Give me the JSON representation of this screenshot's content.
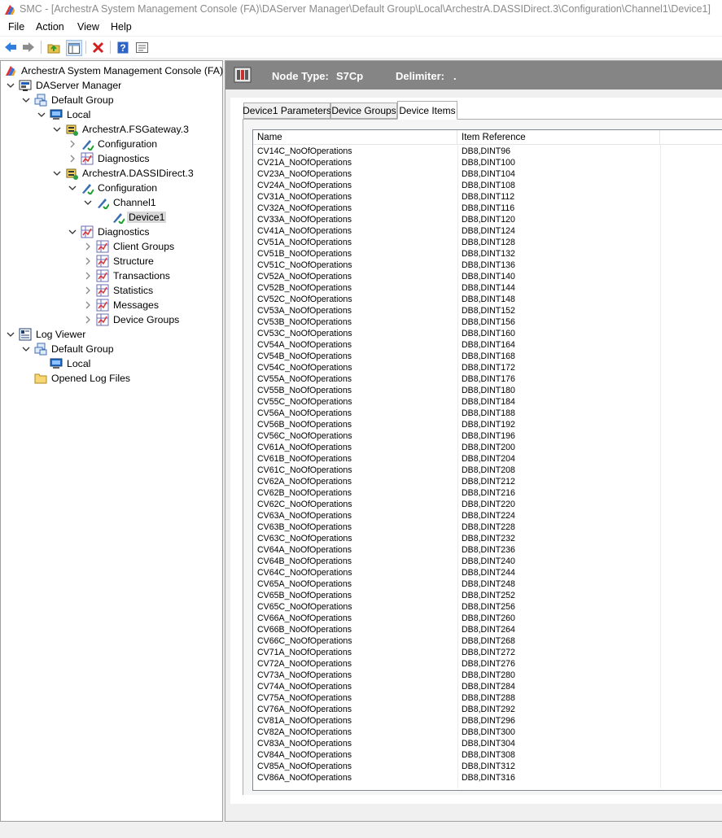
{
  "window": {
    "title": "SMC - [ArchestrA System Management Console (FA)\\DAServer Manager\\Default Group\\Local\\ArchestrA.DASSIDirect.3\\Configuration\\Channel1\\Device1]"
  },
  "menu": [
    "File",
    "Action",
    "View",
    "Help"
  ],
  "toolbar": {
    "icons": [
      "back-arrow-icon",
      "forward-arrow-icon",
      "up-folder-icon",
      "show-hide-tree-icon",
      "delete-icon",
      "help-icon",
      "properties-icon"
    ]
  },
  "tree": [
    {
      "label": "ArchestrA System Management Console (FA)",
      "level": 0,
      "expander": "none",
      "icon": "smc-icon"
    },
    {
      "label": "DAServer Manager",
      "level": 0,
      "expander": "open",
      "icon": "daserver-manager-icon"
    },
    {
      "label": "Default Group",
      "level": 1,
      "expander": "open",
      "icon": "group-icon"
    },
    {
      "label": "Local",
      "level": 2,
      "expander": "open",
      "icon": "computer-icon"
    },
    {
      "label": "ArchestrA.FSGateway.3",
      "level": 3,
      "expander": "open",
      "icon": "server-icon"
    },
    {
      "label": "Configuration",
      "level": 4,
      "expander": "closed",
      "icon": "configuration-icon"
    },
    {
      "label": "Diagnostics",
      "level": 4,
      "expander": "closed",
      "icon": "diagnostics-icon"
    },
    {
      "label": "ArchestrA.DASSIDirect.3",
      "level": 3,
      "expander": "open",
      "icon": "server-icon"
    },
    {
      "label": "Configuration",
      "level": 4,
      "expander": "open",
      "icon": "configuration-icon"
    },
    {
      "label": "Channel1",
      "level": 5,
      "expander": "open",
      "icon": "channel-icon"
    },
    {
      "label": "Device1",
      "level": 6,
      "expander": "none",
      "icon": "device-icon",
      "selected": true
    },
    {
      "label": "Diagnostics",
      "level": 4,
      "expander": "open",
      "icon": "diagnostics-icon"
    },
    {
      "label": "Client Groups",
      "level": 5,
      "expander": "closed",
      "icon": "diagnostics-icon"
    },
    {
      "label": "Structure",
      "level": 5,
      "expander": "closed",
      "icon": "diagnostics-icon"
    },
    {
      "label": "Transactions",
      "level": 5,
      "expander": "closed",
      "icon": "diagnostics-icon"
    },
    {
      "label": "Statistics",
      "level": 5,
      "expander": "closed",
      "icon": "diagnostics-icon"
    },
    {
      "label": "Messages",
      "level": 5,
      "expander": "closed",
      "icon": "diagnostics-icon"
    },
    {
      "label": "Device Groups",
      "level": 5,
      "expander": "closed",
      "icon": "diagnostics-icon"
    },
    {
      "label": "Log Viewer",
      "level": 0,
      "expander": "open",
      "icon": "log-viewer-icon"
    },
    {
      "label": "Default Group",
      "level": 1,
      "expander": "open",
      "icon": "group-icon"
    },
    {
      "label": "Local",
      "level": 2,
      "expander": "none",
      "icon": "computer-icon"
    },
    {
      "label": "Opened Log Files",
      "level": 1,
      "expander": "none",
      "icon": "folder-icon"
    }
  ],
  "header": {
    "node_type_label": "Node Type:",
    "node_type_value": "S7Cp",
    "delimiter_label": "Delimiter:",
    "delimiter_value": "."
  },
  "tabs": [
    {
      "label": "Device1 Parameters",
      "active": false
    },
    {
      "label": "Device Groups",
      "active": false
    },
    {
      "label": "Device Items",
      "active": true
    }
  ],
  "columns": [
    "Name",
    "Item Reference"
  ],
  "items": [
    [
      "CV14C_NoOfOperations",
      "DB8,DINT96"
    ],
    [
      "CV21A_NoOfOperations",
      "DB8,DINT100"
    ],
    [
      "CV23A_NoOfOperations",
      "DB8,DINT104"
    ],
    [
      "CV24A_NoOfOperations",
      "DB8,DINT108"
    ],
    [
      "CV31A_NoOfOperations",
      "DB8,DINT112"
    ],
    [
      "CV32A_NoOfOperations",
      "DB8,DINT116"
    ],
    [
      "CV33A_NoOfOperations",
      "DB8,DINT120"
    ],
    [
      "CV41A_NoOfOperations",
      "DB8,DINT124"
    ],
    [
      "CV51A_NoOfOperations",
      "DB8,DINT128"
    ],
    [
      "CV51B_NoOfOperations",
      "DB8,DINT132"
    ],
    [
      "CV51C_NoOfOperations",
      "DB8,DINT136"
    ],
    [
      "CV52A_NoOfOperations",
      "DB8,DINT140"
    ],
    [
      "CV52B_NoOfOperations",
      "DB8,DINT144"
    ],
    [
      "CV52C_NoOfOperations",
      "DB8,DINT148"
    ],
    [
      "CV53A_NoOfOperations",
      "DB8,DINT152"
    ],
    [
      "CV53B_NoOfOperations",
      "DB8,DINT156"
    ],
    [
      "CV53C_NoOfOperations",
      "DB8,DINT160"
    ],
    [
      "CV54A_NoOfOperations",
      "DB8,DINT164"
    ],
    [
      "CV54B_NoOfOperations",
      "DB8,DINT168"
    ],
    [
      "CV54C_NoOfOperations",
      "DB8,DINT172"
    ],
    [
      "CV55A_NoOfOperations",
      "DB8,DINT176"
    ],
    [
      "CV55B_NoOfOperations",
      "DB8,DINT180"
    ],
    [
      "CV55C_NoOfOperations",
      "DB8,DINT184"
    ],
    [
      "CV56A_NoOfOperations",
      "DB8,DINT188"
    ],
    [
      "CV56B_NoOfOperations",
      "DB8,DINT192"
    ],
    [
      "CV56C_NoOfOperations",
      "DB8,DINT196"
    ],
    [
      "CV61A_NoOfOperations",
      "DB8,DINT200"
    ],
    [
      "CV61B_NoOfOperations",
      "DB8,DINT204"
    ],
    [
      "CV61C_NoOfOperations",
      "DB8,DINT208"
    ],
    [
      "CV62A_NoOfOperations",
      "DB8,DINT212"
    ],
    [
      "CV62B_NoOfOperations",
      "DB8,DINT216"
    ],
    [
      "CV62C_NoOfOperations",
      "DB8,DINT220"
    ],
    [
      "CV63A_NoOfOperations",
      "DB8,DINT224"
    ],
    [
      "CV63B_NoOfOperations",
      "DB8,DINT228"
    ],
    [
      "CV63C_NoOfOperations",
      "DB8,DINT232"
    ],
    [
      "CV64A_NoOfOperations",
      "DB8,DINT236"
    ],
    [
      "CV64B_NoOfOperations",
      "DB8,DINT240"
    ],
    [
      "CV64C_NoOfOperations",
      "DB8,DINT244"
    ],
    [
      "CV65A_NoOfOperations",
      "DB8,DINT248"
    ],
    [
      "CV65B_NoOfOperations",
      "DB8,DINT252"
    ],
    [
      "CV65C_NoOfOperations",
      "DB8,DINT256"
    ],
    [
      "CV66A_NoOfOperations",
      "DB8,DINT260"
    ],
    [
      "CV66B_NoOfOperations",
      "DB8,DINT264"
    ],
    [
      "CV66C_NoOfOperations",
      "DB8,DINT268"
    ],
    [
      "CV71A_NoOfOperations",
      "DB8,DINT272"
    ],
    [
      "CV72A_NoOfOperations",
      "DB8,DINT276"
    ],
    [
      "CV73A_NoOfOperations",
      "DB8,DINT280"
    ],
    [
      "CV74A_NoOfOperations",
      "DB8,DINT284"
    ],
    [
      "CV75A_NoOfOperations",
      "DB8,DINT288"
    ],
    [
      "CV76A_NoOfOperations",
      "DB8,DINT292"
    ],
    [
      "CV81A_NoOfOperations",
      "DB8,DINT296"
    ],
    [
      "CV82A_NoOfOperations",
      "DB8,DINT300"
    ],
    [
      "CV83A_NoOfOperations",
      "DB8,DINT304"
    ],
    [
      "CV84A_NoOfOperations",
      "DB8,DINT308"
    ],
    [
      "CV85A_NoOfOperations",
      "DB8,DINT312"
    ],
    [
      "CV86A_NoOfOperations",
      "DB8,DINT316"
    ]
  ]
}
